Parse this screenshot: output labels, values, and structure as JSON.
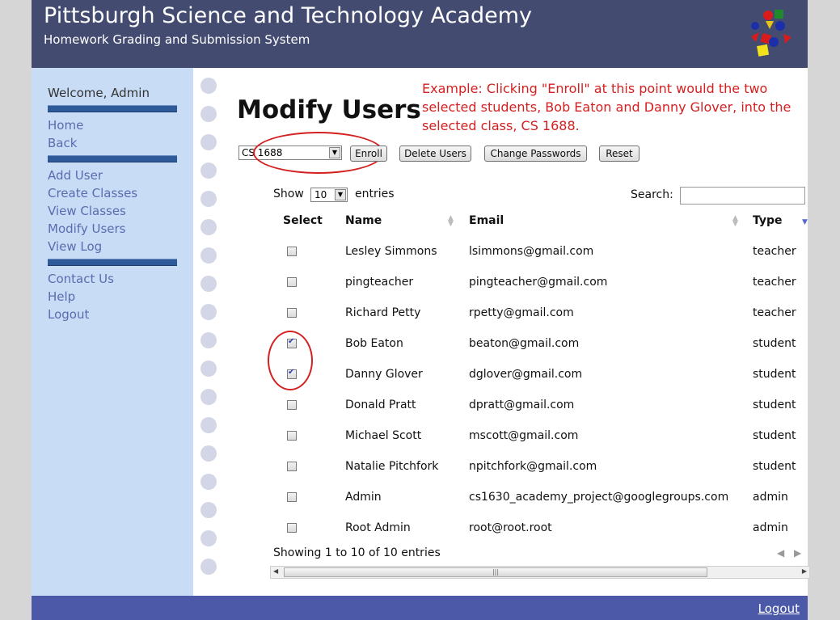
{
  "header": {
    "title": "Pittsburgh Science and Technology Academy",
    "subtitle": "Homework Grading and Submission System"
  },
  "sidebar": {
    "welcome": "Welcome, Admin",
    "group1": [
      "Home",
      "Back"
    ],
    "group2": [
      "Add User",
      "Create Classes",
      "View Classes",
      "Modify Users",
      "View Log"
    ],
    "group3": [
      "Contact Us",
      "Help",
      "Logout"
    ]
  },
  "main": {
    "title": "Modify Users",
    "annotation": "Example: Clicking \"Enroll\" at this point would the two selected students, Bob Eaton and Danny Glover, into the selected class, CS 1688.",
    "class_select": "CS 1688",
    "buttons": {
      "enroll": "Enroll",
      "delete": "Delete Users",
      "change_pw": "Change Passwords",
      "reset": "Reset"
    },
    "show_label": "Show",
    "entries_value": "10",
    "entries_label": "entries",
    "search_label": "Search:",
    "search_value": "",
    "columns": [
      "Select",
      "Name",
      "Email",
      "Type"
    ],
    "rows": [
      {
        "name": "Lesley Simmons",
        "email": "lsimmons@gmail.com",
        "type": "teacher",
        "checked": false
      },
      {
        "name": "pingteacher",
        "email": "pingteacher@gmail.com",
        "type": "teacher",
        "checked": false
      },
      {
        "name": "Richard Petty",
        "email": "rpetty@gmail.com",
        "type": "teacher",
        "checked": false
      },
      {
        "name": "Bob Eaton",
        "email": "beaton@gmail.com",
        "type": "student",
        "checked": true
      },
      {
        "name": "Danny Glover",
        "email": "dglover@gmail.com",
        "type": "student",
        "checked": true
      },
      {
        "name": "Donald Pratt",
        "email": "dpratt@gmail.com",
        "type": "student",
        "checked": false
      },
      {
        "name": "Michael Scott",
        "email": "mscott@gmail.com",
        "type": "student",
        "checked": false
      },
      {
        "name": "Natalie Pitchfork",
        "email": "npitchfork@gmail.com",
        "type": "student",
        "checked": false
      },
      {
        "name": "Admin",
        "email": "cs1630_academy_project@googlegroups.com",
        "type": "admin",
        "checked": false
      },
      {
        "name": "Root Admin",
        "email": "root@root.root",
        "type": "admin",
        "checked": false
      }
    ],
    "info": "Showing 1 to 10 of 10 entries"
  },
  "footer": {
    "logout": "Logout"
  },
  "colors": {
    "header": "#434b70",
    "sidebar": "#c8dcf5",
    "footer": "#4b59a8",
    "annotation": "#d42020"
  }
}
